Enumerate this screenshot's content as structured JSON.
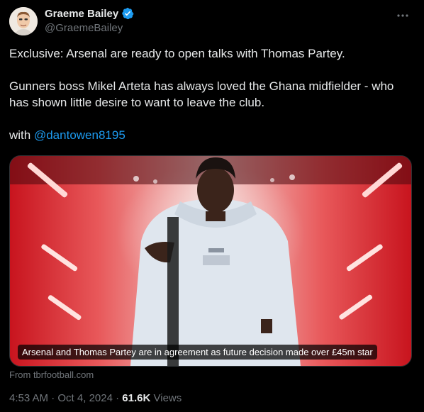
{
  "author": {
    "display_name": "Graeme Bailey",
    "handle": "@GraemeBailey",
    "verified": true
  },
  "tweet": {
    "line1": "Exclusive: Arsenal are ready to open talks with Thomas Partey.",
    "line2": "Gunners boss Mikel Arteta has always loved the Ghana midfielder - who has shown little desire to want to leave the club.",
    "with_prefix": "with",
    "mention": "@dantowen8195"
  },
  "card": {
    "caption": "Arsenal and Thomas Partey are in agreement as future decision made over £45m star",
    "source": "From tbrfootball.com"
  },
  "meta": {
    "time": "4:53 AM",
    "separator": "·",
    "date": "Oct 4, 2024",
    "views_count": "61.6K",
    "views_label": "Views"
  },
  "colors": {
    "background": "#000000",
    "text": "#e7e9ea",
    "muted": "#71767b",
    "link": "#1d9bf0",
    "verified": "#1d9bf0"
  },
  "icons": {
    "verified": "verified-badge-icon",
    "more": "more-options-icon"
  }
}
